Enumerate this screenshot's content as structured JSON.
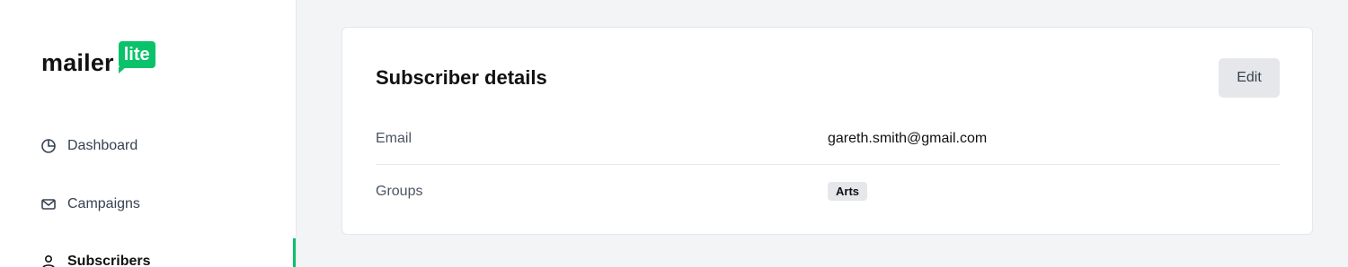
{
  "brand": {
    "word": "mailer",
    "bubble": "lite",
    "accent": "#09c269"
  },
  "sidebar": {
    "items": [
      {
        "label": "Dashboard",
        "icon": "pie-chart-icon"
      },
      {
        "label": "Campaigns",
        "icon": "envelope-icon"
      },
      {
        "label": "Subscribers",
        "icon": "user-icon",
        "active": true
      }
    ]
  },
  "card": {
    "title": "Subscriber details",
    "edit_label": "Edit",
    "rows": [
      {
        "label": "Email",
        "value": "gareth.smith@gmail.com"
      },
      {
        "label": "Groups",
        "tag": "Arts"
      }
    ]
  }
}
